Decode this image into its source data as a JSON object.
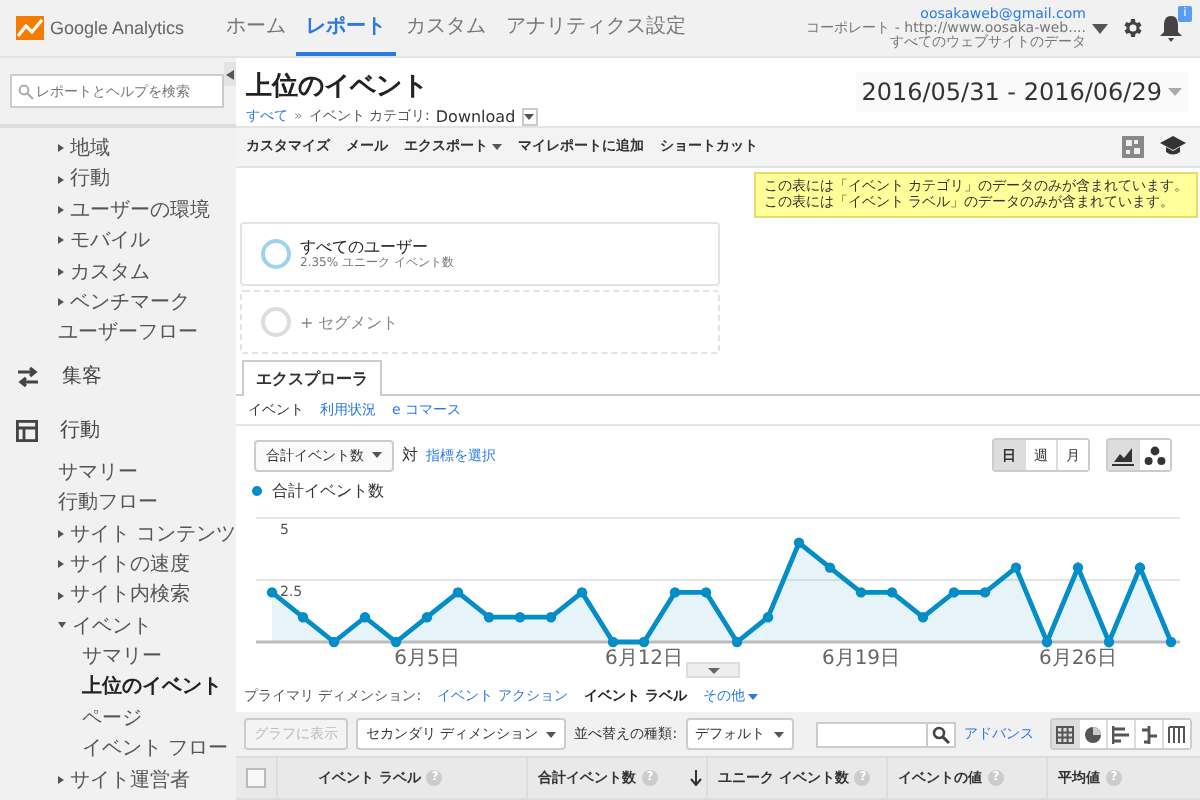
{
  "topbar": {
    "logo": "Google Analytics",
    "tabs": [
      {
        "label": "ホーム",
        "selected": false
      },
      {
        "label": "レポート",
        "selected": true
      },
      {
        "label": "カスタム",
        "selected": false
      },
      {
        "label": "アナリティクス設定",
        "selected": false
      }
    ],
    "account": {
      "email": "oosakaweb@gmail.com",
      "property": "コーポレート - http://www.oosaka-web....",
      "view": "すべてのウェブサイトのデータ"
    },
    "notification_badge": "i"
  },
  "sidebar": {
    "search": {
      "placeholder": "レポートとヘルプを検索"
    },
    "items": [
      {
        "kind": "group",
        "label": "地域",
        "expanded": false
      },
      {
        "kind": "group",
        "label": "行動",
        "expanded": false
      },
      {
        "kind": "group",
        "label": "ユーザーの環境",
        "expanded": false
      },
      {
        "kind": "group",
        "label": "モバイル",
        "expanded": false
      },
      {
        "kind": "group",
        "label": "カスタム",
        "expanded": false
      },
      {
        "kind": "group",
        "label": "ベンチマーク",
        "expanded": false
      },
      {
        "kind": "link",
        "label": "ユーザーフロー",
        "selected": false
      },
      {
        "kind": "section",
        "label": "集客"
      },
      {
        "kind": "section",
        "label": "行動"
      },
      {
        "kind": "link",
        "label": "サマリー",
        "selected": false
      },
      {
        "kind": "link",
        "label": "行動フロー",
        "selected": false
      },
      {
        "kind": "group",
        "label": "サイト コンテンツ",
        "expanded": false
      },
      {
        "kind": "group",
        "label": "サイトの速度",
        "expanded": false
      },
      {
        "kind": "group",
        "label": "サイト内検索",
        "expanded": false
      },
      {
        "kind": "group",
        "label": "イベント",
        "expanded": true,
        "children": [
          {
            "label": "サマリー",
            "selected": false
          },
          {
            "label": "上位のイベント",
            "selected": true
          },
          {
            "label": "ページ",
            "selected": false
          },
          {
            "label": "イベント フロー",
            "selected": false
          }
        ]
      },
      {
        "kind": "group",
        "label": "サイト運営者",
        "expanded": false
      }
    ]
  },
  "header": {
    "title": "上位のイベント",
    "breadcrumb_link": "すべて",
    "breadcrumb_sep": "»",
    "breadcrumb_label": "イベント カテゴリ:",
    "breadcrumb_value": "Download",
    "date_range": "2016/05/31 - 2016/06/29"
  },
  "toolbar": {
    "buttons": [
      {
        "label": "カスタマイズ",
        "kind": "button"
      },
      {
        "label": "メール",
        "kind": "button"
      },
      {
        "label": "エクスポート",
        "kind": "menu"
      },
      {
        "label": "マイレポートに追加",
        "kind": "button"
      },
      {
        "label": "ショートカット",
        "kind": "button"
      }
    ]
  },
  "notice": [
    "この表には「イベント カテゴリ」のデータのみが含まれています。",
    "この表には「イベント ラベル」のデータのみが含まれています。"
  ],
  "segments": [
    {
      "kind": "segment",
      "name": "すべてのユーザー",
      "detail": "2.35% ユニーク イベント数"
    },
    {
      "kind": "add",
      "name": "+ セグメント"
    }
  ],
  "explorer": {
    "tab": "エクスプローラ",
    "subtabs": [
      {
        "label": "イベント",
        "selected": true
      },
      {
        "label": "利用状況",
        "selected": false
      },
      {
        "label": "e コマース",
        "selected": false
      }
    ],
    "metric": "合計イベント数",
    "versus": "対",
    "select_metric": "指標を選択",
    "periods": [
      {
        "label": "日",
        "selected": true
      },
      {
        "label": "週",
        "selected": false
      },
      {
        "label": "月",
        "selected": false
      }
    ],
    "chart_types": [
      {
        "kind": "line",
        "selected": true
      },
      {
        "kind": "motion",
        "selected": false
      }
    ],
    "chart_data": {
      "type": "area",
      "ylim": [
        0,
        5
      ],
      "yticks": [
        {
          "value": 2.5,
          "label": "2.5"
        },
        {
          "value": 5,
          "label": "5"
        }
      ],
      "categories": [
        null,
        null,
        null,
        null,
        null,
        "6月5日",
        null,
        null,
        null,
        null,
        null,
        null,
        "6月12日",
        null,
        null,
        null,
        null,
        null,
        null,
        "6月19日",
        null,
        null,
        null,
        null,
        null,
        null,
        "6月26日",
        null,
        null,
        null
      ],
      "series": [
        {
          "name": "合計イベント数",
          "color": "#058dc7",
          "values": [
            2,
            1,
            0,
            1,
            0,
            1,
            2,
            1,
            1,
            1,
            2,
            0,
            0,
            2,
            2,
            0,
            1,
            4,
            3,
            2,
            2,
            1,
            2,
            2,
            3,
            0,
            3,
            0,
            3,
            0
          ]
        }
      ]
    }
  },
  "dimensions": {
    "label": "プライマリ ディメンション:",
    "options": [
      {
        "label": "イベント アクション",
        "selected": false
      },
      {
        "label": "イベント ラベル",
        "selected": true
      }
    ],
    "more": "その他"
  },
  "table_toolbar": {
    "plot_button": "グラフに表示",
    "plot_disabled": true,
    "secondary": "セカンダリ ディメンション",
    "sort_label": "並べ替えの種類:",
    "sort_value": "デフォルト",
    "advanced": "アドバンス",
    "views": [
      {
        "kind": "table",
        "selected": true
      },
      {
        "kind": "pie",
        "selected": false
      },
      {
        "kind": "bars",
        "selected": false
      },
      {
        "kind": "compare",
        "selected": false
      },
      {
        "kind": "pivot",
        "selected": false
      }
    ]
  },
  "table": {
    "select_all_checked": false,
    "columns": [
      {
        "label": "イベント ラベル",
        "help": "?",
        "sorted": false
      },
      {
        "label": "合計イベント数",
        "help": "?",
        "sorted": true
      },
      {
        "label": "ユニーク イベント数",
        "help": "?",
        "sorted": false
      },
      {
        "label": "イベントの値",
        "help": "?",
        "sorted": false
      },
      {
        "label": "平均値",
        "help": "?",
        "sorted": false
      }
    ]
  }
}
